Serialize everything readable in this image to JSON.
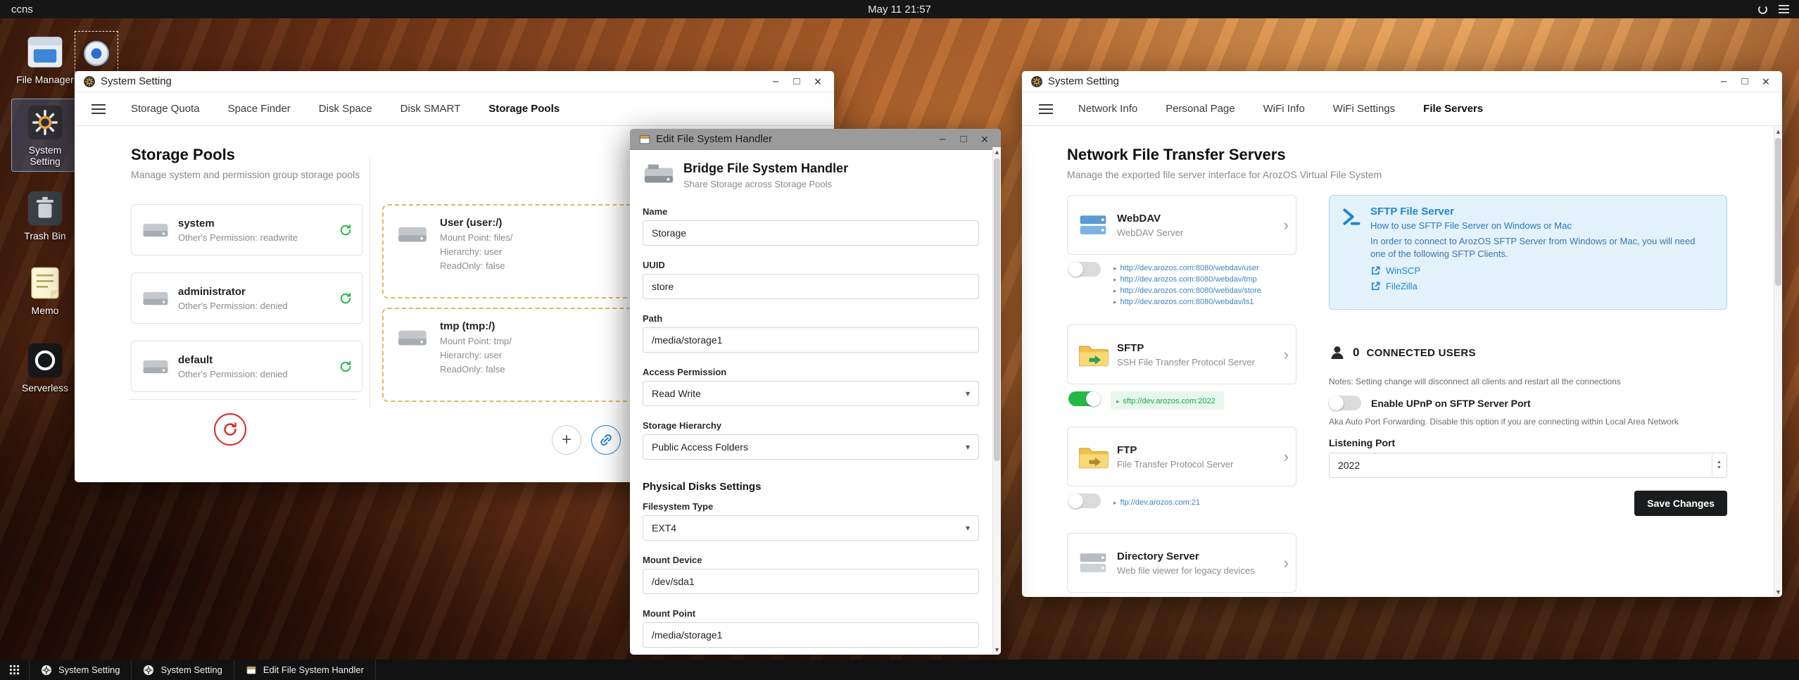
{
  "topbar": {
    "host": "ccns",
    "clock": "May 11 21:57"
  },
  "desktop": {
    "icons": [
      {
        "label": "File Manager"
      },
      {
        "label": "System Setting"
      },
      {
        "label": "Trash Bin"
      },
      {
        "label": "Memo"
      },
      {
        "label": "Serverless"
      }
    ]
  },
  "storage_window": {
    "title": "System Setting",
    "tabs": [
      "Storage Quota",
      "Space Finder",
      "Disk Space",
      "Disk SMART",
      "Storage Pools"
    ],
    "heading": "Storage Pools",
    "subheading": "Manage system and permission group storage pools",
    "pools": [
      {
        "name": "system",
        "permission": "Other's Permission: readwrite"
      },
      {
        "name": "administrator",
        "permission": "Other's Permission: denied"
      },
      {
        "name": "default",
        "permission": "Other's Permission: denied"
      }
    ],
    "mounts": [
      {
        "name": "User (user:/)",
        "mount": "Mount Point: files/",
        "hierarchy": "Hierarchy: user",
        "readonly": "ReadOnly: false"
      },
      {
        "name": "tmp (tmp:/)",
        "mount": "Mount Point: tmp/",
        "hierarchy": "Hierarchy: user",
        "readonly": "ReadOnly: false"
      }
    ]
  },
  "editor_window": {
    "title": "Edit File System Handler",
    "heading": "Bridge File System Handler",
    "subheading": "Share Storage across Storage Pools",
    "name_label": "Name",
    "name_value": "Storage",
    "uuid_label": "UUID",
    "uuid_value": "store",
    "path_label": "Path",
    "path_value": "/media/storage1",
    "access_label": "Access Permission",
    "access_value": "Read Write",
    "hierarchy_label": "Storage Hierarchy",
    "hierarchy_value": "Public Access Folders",
    "disks_section": "Physical Disks Settings",
    "fstype_label": "Filesystem Type",
    "fstype_value": "EXT4",
    "mount_device_label": "Mount Device",
    "mount_device_value": "/dev/sda1",
    "mount_point_label": "Mount Point",
    "mount_point_value": "/media/storage1"
  },
  "network_window": {
    "title": "System Setting",
    "tabs": [
      "Network Info",
      "Personal Page",
      "WiFi Info",
      "WiFi Settings",
      "File Servers"
    ],
    "heading": "Network File Transfer Servers",
    "subheading": "Manage the exported file server interface for ArozOS Virtual File System",
    "webdav": {
      "name": "WebDAV",
      "desc": "WebDAV Server",
      "links": [
        "http://dev.arozos.com:8080/webdav/user",
        "http://dev.arozos.com:8080/webdav/tmp",
        "http://dev.arozos.com:8080/webdav/store",
        "http://dev.arozos.com:8080/webdav/ls1"
      ]
    },
    "sftp": {
      "name": "SFTP",
      "desc": "SSH File Transfer Protocol Server",
      "link": "sftp://dev.arozos.com:2022"
    },
    "ftp": {
      "name": "FTP",
      "desc": "File Transfer Protocol Server",
      "link": "ftp://dev.arozos.com:21"
    },
    "dirserver": {
      "name": "Directory Server",
      "desc": "Web file viewer for legacy devices"
    },
    "help": {
      "title": "SFTP File Server",
      "subtitle": "How to use SFTP File Server on Windows or Mac",
      "body": "In order to connect to ArozOS SFTP Server from Windows or Mac, you will need one of the following SFTP Clients.",
      "client1": "WinSCP",
      "client2": "FileZilla"
    },
    "connected_count": "0",
    "connected_label": "CONNECTED USERS",
    "connected_note": "Notes: Setting change will disconnect all clients and restart all the connections",
    "upnp_label": "Enable UPnP on SFTP Server Port",
    "upnp_desc": "Aka Auto Port Forwarding. Disable this option if you are connecting within Local Area Network",
    "port_label": "Listening Port",
    "port_value": "2022",
    "save_label": "Save Changes"
  },
  "taskbar": {
    "items": [
      "System Setting",
      "System Setting",
      "Edit File System Handler"
    ]
  }
}
